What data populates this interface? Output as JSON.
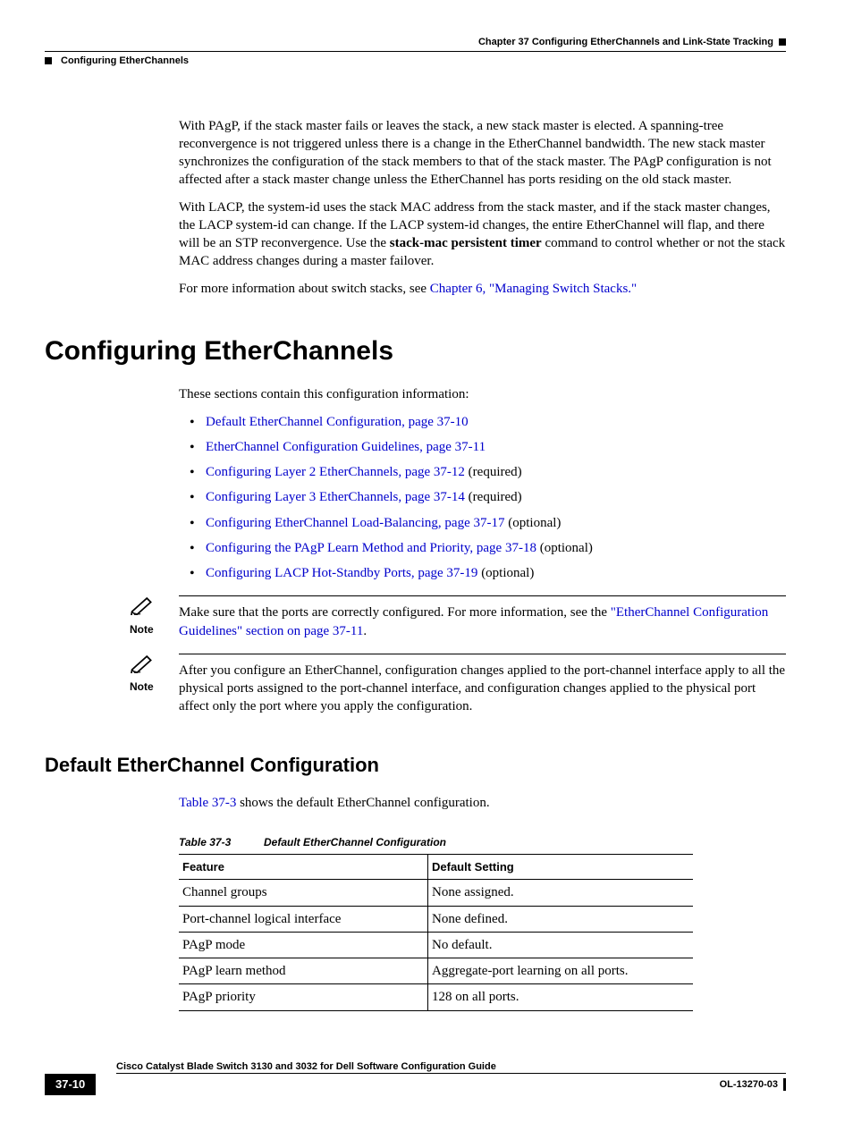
{
  "header": {
    "chapter": "Chapter 37      Configuring EtherChannels and Link-State Tracking",
    "section": "Configuring EtherChannels"
  },
  "intro": {
    "p1": "With PAgP, if the stack master fails or leaves the stack, a new stack master is elected. A spanning-tree reconvergence is not triggered unless there is a change in the EtherChannel bandwidth. The new stack master synchronizes the configuration of the stack members to that of the stack master. The PAgP configuration is not affected after a stack master change unless the EtherChannel has ports residing on the old stack master.",
    "p2_a": "With LACP, the system-id uses the stack MAC address from the stack master, and if the stack master changes, the LACP system-id can change. If the LACP system-id changes, the entire EtherChannel will flap, and there will be an STP reconvergence. Use the ",
    "p2_bold": "stack-mac persistent timer",
    "p2_b": " command to control whether or not the stack MAC address changes during a master failover.",
    "p3_a": "For more information about switch stacks, see ",
    "p3_link": "Chapter 6, \"Managing Switch Stacks.\""
  },
  "h1": "Configuring EtherChannels",
  "toc_intro": "These sections contain this configuration information:",
  "toc": [
    {
      "link": "Default EtherChannel Configuration, page 37-10",
      "suffix": ""
    },
    {
      "link": "EtherChannel Configuration Guidelines, page 37-11",
      "suffix": ""
    },
    {
      "link": "Configuring Layer 2 EtherChannels, page 37-12",
      "suffix": " (required)"
    },
    {
      "link": "Configuring Layer 3 EtherChannels, page 37-14",
      "suffix": " (required)"
    },
    {
      "link": "Configuring EtherChannel Load-Balancing, page 37-17",
      "suffix": " (optional)"
    },
    {
      "link": "Configuring the PAgP Learn Method and Priority, page 37-18",
      "suffix": " (optional)"
    },
    {
      "link": "Configuring LACP Hot-Standby Ports, page 37-19",
      "suffix": " (optional)"
    }
  ],
  "note_label": "Note",
  "note1_a": "Make sure that the ports are correctly configured. For more information, see the ",
  "note1_link": "\"EtherChannel Configuration Guidelines\" section on page 37-11",
  "note1_b": ".",
  "note2": "After you configure an EtherChannel, configuration changes applied to the port-channel interface apply to all the physical ports assigned to the port-channel interface, and configuration changes applied to the physical port affect only the port where you apply the configuration.",
  "h2": "Default EtherChannel Configuration",
  "h2_intro_link": "Table 37-3",
  "h2_intro_rest": " shows the default EtherChannel configuration.",
  "table_caption_num": "Table 37-3",
  "table_caption_title": "Default EtherChannel Configuration",
  "table": {
    "headers": [
      "Feature",
      "Default Setting"
    ],
    "rows": [
      [
        "Channel groups",
        "None assigned."
      ],
      [
        "Port-channel logical interface",
        "None defined."
      ],
      [
        "PAgP mode",
        "No default."
      ],
      [
        "PAgP learn method",
        "Aggregate-port learning on all ports."
      ],
      [
        "PAgP priority",
        "128 on all ports."
      ]
    ]
  },
  "footer": {
    "title": "Cisco Catalyst Blade Switch 3130 and 3032 for Dell Software Configuration Guide",
    "page": "37-10",
    "docid": "OL-13270-03"
  }
}
